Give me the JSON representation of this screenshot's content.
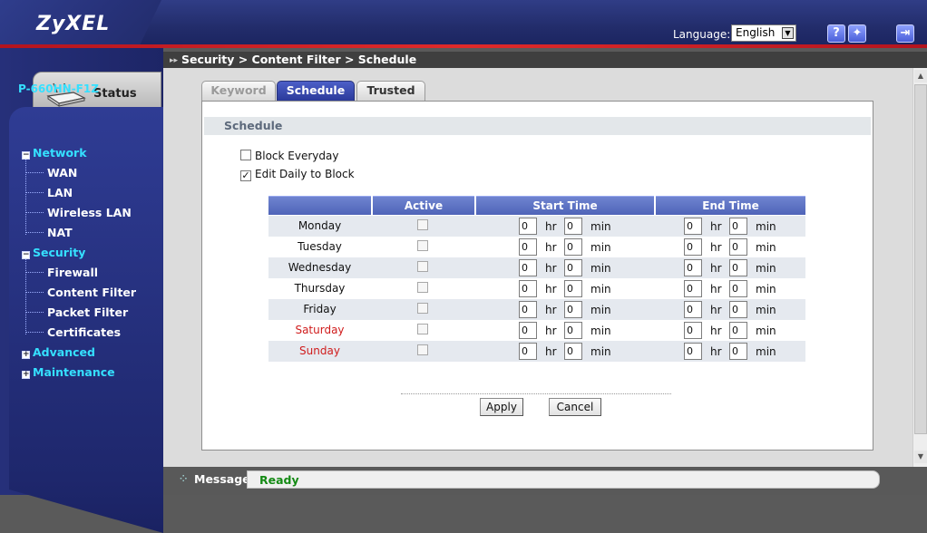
{
  "header": {
    "brand": "ZyXEL",
    "language_label": "Language:",
    "language_value": "English",
    "help_glyph": "?",
    "wizard_glyph": "✦",
    "logout_glyph": "⇥",
    "icons": [
      "help-icon",
      "wizard-icon",
      "logout-icon"
    ]
  },
  "sidebar": {
    "status_label": "Status",
    "model": "P-660HN-F1Z",
    "groups": [
      {
        "label": "Network",
        "expanded": true,
        "items": [
          "WAN",
          "LAN",
          "Wireless LAN",
          "NAT"
        ]
      },
      {
        "label": "Security",
        "expanded": true,
        "items": [
          "Firewall",
          "Content Filter",
          "Packet Filter",
          "Certificates"
        ]
      },
      {
        "label": "Advanced",
        "expanded": false,
        "items": []
      },
      {
        "label": "Maintenance",
        "expanded": false,
        "items": []
      }
    ]
  },
  "breadcrumb": "Security > Content Filter > Schedule",
  "tabs": [
    {
      "label": "Keyword",
      "state": "inactive"
    },
    {
      "label": "Schedule",
      "state": "active"
    },
    {
      "label": "Trusted",
      "state": "normal"
    }
  ],
  "section_title": "Schedule",
  "options": {
    "block_everyday": {
      "label": "Block Everyday",
      "checked": false
    },
    "edit_daily": {
      "label": "Edit Daily to Block",
      "checked": true
    }
  },
  "table": {
    "headers": {
      "day": "",
      "active": "Active",
      "start": "Start Time",
      "end": "End Time"
    },
    "unit_hr": "hr",
    "unit_min": "min",
    "rows": [
      {
        "day": "Monday",
        "weekend": false,
        "active": false,
        "start_hr": "0",
        "start_min": "0",
        "end_hr": "0",
        "end_min": "0"
      },
      {
        "day": "Tuesday",
        "weekend": false,
        "active": false,
        "start_hr": "0",
        "start_min": "0",
        "end_hr": "0",
        "end_min": "0"
      },
      {
        "day": "Wednesday",
        "weekend": false,
        "active": false,
        "start_hr": "0",
        "start_min": "0",
        "end_hr": "0",
        "end_min": "0"
      },
      {
        "day": "Thursday",
        "weekend": false,
        "active": false,
        "start_hr": "0",
        "start_min": "0",
        "end_hr": "0",
        "end_min": "0"
      },
      {
        "day": "Friday",
        "weekend": false,
        "active": false,
        "start_hr": "0",
        "start_min": "0",
        "end_hr": "0",
        "end_min": "0"
      },
      {
        "day": "Saturday",
        "weekend": true,
        "active": false,
        "start_hr": "0",
        "start_min": "0",
        "end_hr": "0",
        "end_min": "0"
      },
      {
        "day": "Sunday",
        "weekend": true,
        "active": false,
        "start_hr": "0",
        "start_min": "0",
        "end_hr": "0",
        "end_min": "0"
      }
    ]
  },
  "buttons": {
    "apply": "Apply",
    "cancel": "Cancel"
  },
  "statusbar": {
    "label": "Message",
    "value": "Ready"
  },
  "colors": {
    "header_blue": "#222c6a",
    "accent_red": "#e02a2a",
    "nav_cyan": "#35e0ff",
    "table_header": "#5b70c0",
    "weekend_red": "#d01c1c",
    "ready_green": "#148a14"
  }
}
